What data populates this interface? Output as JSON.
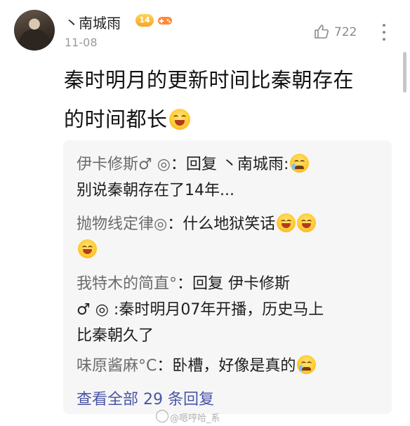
{
  "post": {
    "username": "丶南城雨",
    "level_badge": "14",
    "timestamp": "11-08",
    "like_count": "722",
    "text_line1": "秦时明月的更新时间比秦朝存在",
    "text_line2": "的时间都长"
  },
  "replies": {
    "r1": {
      "name": "伊卡修斯♂ ◎",
      "text1": "：回复 ",
      "mention": "丶南城雨",
      "text2": ":",
      "line2": "别说秦朝存在了14年..."
    },
    "r2": {
      "name": "抛物线定律◎",
      "text": "：什么地狱笑话"
    },
    "r3": {
      "name": "我特木的简直°",
      "line1_text": "：回复 伊卡修斯",
      "line2": "♂ ◎ :秦时明月07年开播，历史马上",
      "line3": "比秦朝久了"
    },
    "r4": {
      "name": "味原酱麻°C",
      "text": "：卧槽，好像是真的"
    },
    "view_all": "查看全部 29 条回复"
  },
  "watermark": "@嗯哼哈_系",
  "icons": {
    "like": "thumbs-up-icon",
    "more": "vertical-dots-icon",
    "emoji_grin": "grinning-face-emoji",
    "emoji_cry": "crying-face-emoji"
  },
  "colors": {
    "link": "#4a55a6",
    "reply_bg": "#f6f6f6",
    "muted": "#9a9a9a"
  }
}
